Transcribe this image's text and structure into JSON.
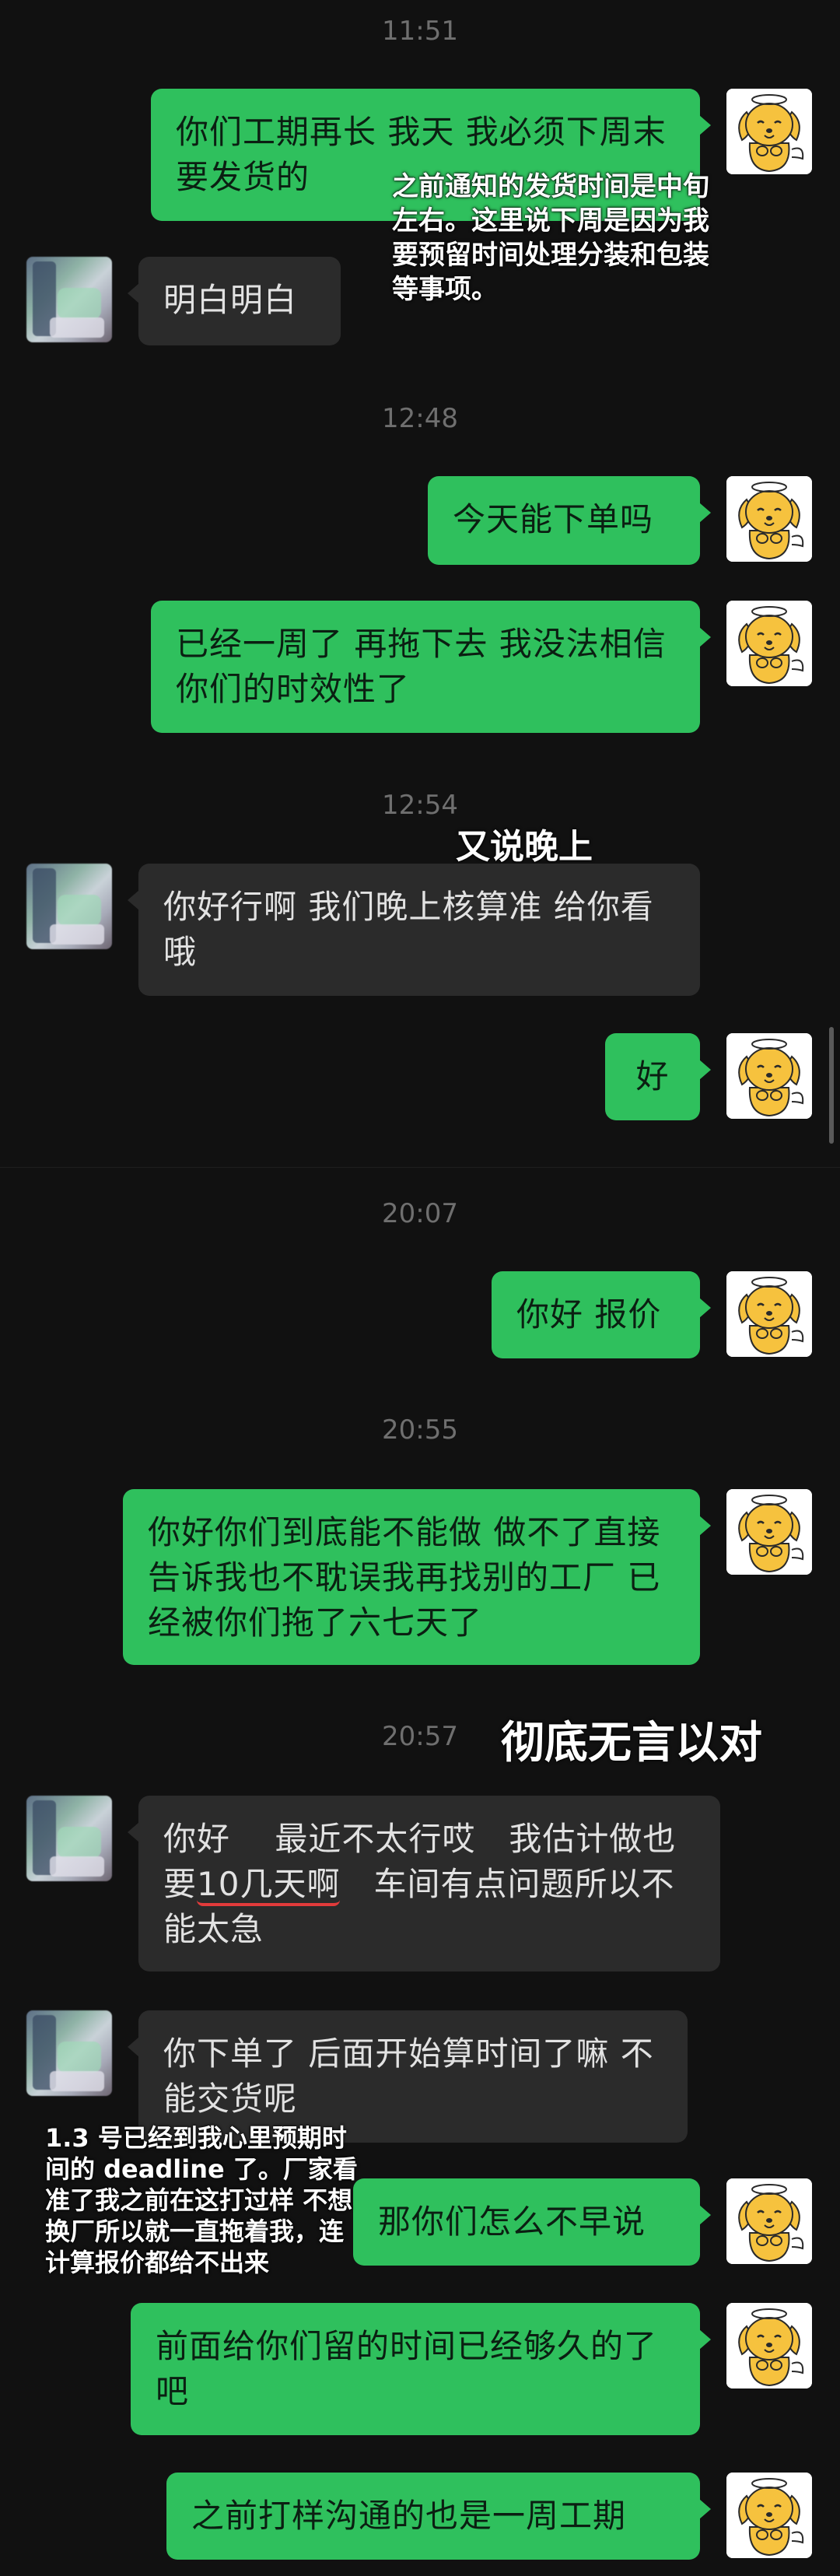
{
  "times": [
    "11:51",
    "12:48",
    "12:54",
    "20:07",
    "20:55",
    "20:57"
  ],
  "messages": {
    "m1": "你们工期再长 我天 我必须下周末要发货的",
    "m2": "明白明白",
    "m3": "今天能下单吗",
    "m4": "已经一周了 再拖下去 我没法相信你们的时效性了",
    "m5": "你好行啊 我们晚上核算准 给你看哦",
    "m6": "好",
    "m7": "你好 报价",
    "m8": "你好你们到底能不能做 做不了直接告诉我也不耽误我再找别的工厂 已经被你们拖了六七天了",
    "m9": {
      "part1": "你好　 最近不太行哎　我估计做也要",
      "underlined": "10几天啊",
      "part2": "　车间有点问题所以不能太急"
    },
    "m10": "你下单了 后面开始算时间了嘛 不能交货呢",
    "m11": "那你们怎么不早说",
    "m12": "前面给你们留的时间已经够久的了吧",
    "m13": "之前打样沟通的也是一周工期"
  },
  "annotations": {
    "a1": "之前通知的发货时间是中旬左右。这里说下周是因为我要预留时间处理分装和包装等事项。",
    "a2": "又说晚上",
    "a3": "彻底无言以对",
    "a4": "1.3 号已经到我心里预期时间的 deadline 了。厂家看准了我之前在这打过样 不想换厂所以就一直拖着我，连计算报价都给不出来"
  },
  "colors": {
    "background": "#111111",
    "my_bubble": "#2fc05d",
    "their_bubble": "#2b2b2b",
    "annotation_text": "#ffffff",
    "underline": "#e23b3b"
  },
  "icons": {
    "my_avatar": "cartoon-dog-avatar",
    "their_avatar": "blurred-photo-avatar"
  }
}
